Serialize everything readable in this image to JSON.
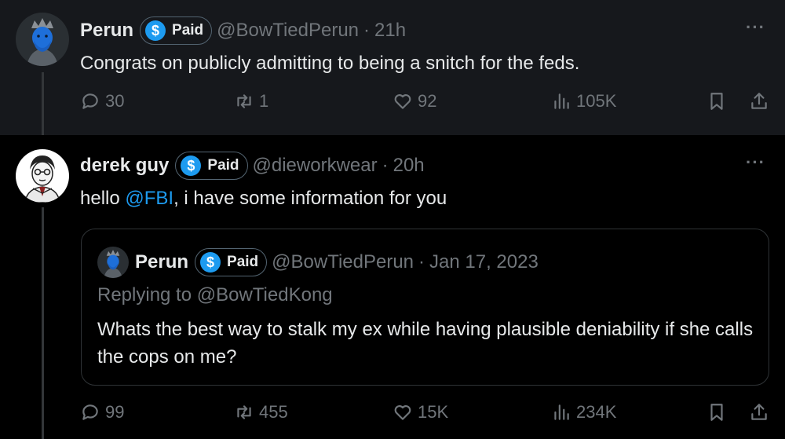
{
  "tweet1": {
    "name": "Perun",
    "paid_label": "Paid",
    "coin": "$",
    "handle": "@BowTiedPerun",
    "separator": "·",
    "time": "21h",
    "more": "···",
    "text": "Congrats on publicly admitting to being a snitch for the feds.",
    "replies": "30",
    "reposts": "1",
    "likes": "92",
    "views": "105K"
  },
  "tweet2": {
    "name": "derek guy",
    "paid_label": "Paid",
    "coin": "$",
    "handle": "@dieworkwear",
    "separator": "·",
    "time": "20h",
    "more": "···",
    "text_before": "hello ",
    "mention": "@FBI",
    "text_after": ", i have some information for you",
    "replies": "99",
    "reposts": "455",
    "likes": "15K",
    "views": "234K",
    "quote": {
      "name": "Perun",
      "paid_label": "Paid",
      "coin": "$",
      "handle": "@BowTiedPerun",
      "separator": "·",
      "date": "Jan 17, 2023",
      "replying_to": "Replying to @BowTiedKong",
      "text": "Whats the best way to stalk my ex while having plausible deniability if she calls the cops on me?"
    }
  },
  "colors": {
    "accent": "#1d9bf0",
    "muted": "#71767b",
    "text": "#e7e9ea",
    "bg_highlight": "#16181c",
    "bg": "#000000"
  },
  "icons": [
    "reply-icon",
    "repost-icon",
    "like-icon",
    "views-icon",
    "bookmark-icon",
    "share-icon",
    "more-icon",
    "paid-coin-icon"
  ]
}
